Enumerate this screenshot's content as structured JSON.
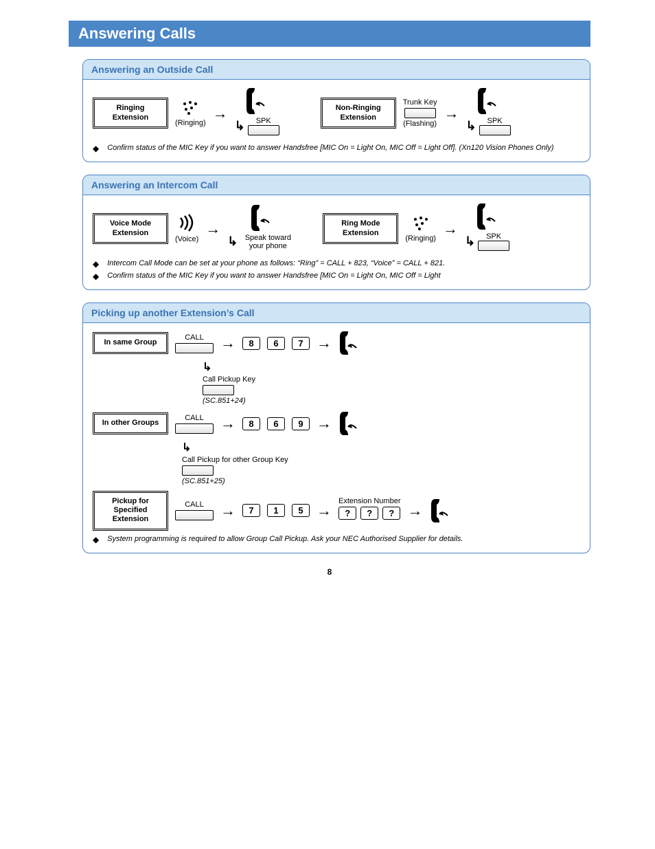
{
  "pageTitle": "Answering Calls",
  "pageNumber": "8",
  "sections": {
    "outside": {
      "header": "Answering an Outside Call",
      "ringing_ext": "Ringing Extension",
      "ringing_lbl": "(Ringing)",
      "spk": "SPK",
      "nonringing_ext": "Non-Ringing Extension",
      "trunk_key": "Trunk Key",
      "flashing_lbl": "(Flashing)",
      "note1": "Confirm status of the MIC Key if you want to answer Handsfree [MIC On = Light On, MIC Off = Light Off].   (Xn120 Vision Phones Only)"
    },
    "intercom": {
      "header": "Answering an Intercom Call",
      "voice_ext": "Voice Mode Extension",
      "voice_lbl": "(Voice)",
      "speak": "Speak toward your phone",
      "ring_ext": "Ring Mode Extension",
      "ringing_lbl": "(Ringing)",
      "spk": "SPK",
      "note1": "Intercom Call Mode can be set at your phone as follows:   “Ring” = CALL + 823,   “Voice” = CALL + 821.",
      "note2": "Confirm status of the MIC Key if you want to answer Handsfree [MIC On = Light On, MIC Off = Light"
    },
    "pickup": {
      "header": "Picking up another Extension’s Call",
      "same_group": "In same Group",
      "other_groups": "In other Groups",
      "specified": "Pickup for Specified Extension",
      "call": "CALL",
      "call_pickup_key": "Call Pickup Key",
      "sc24": "(SC.851+24)",
      "call_pickup_other": "Call Pickup for other Group Key",
      "sc25": "(SC.851+25)",
      "ext_num": "Extension Number",
      "digits": {
        "d8": "8",
        "d6": "6",
        "d7": "7",
        "d9": "9",
        "d1": "1",
        "d5": "5",
        "dq": "?"
      },
      "note1": "System programming is required to allow Group Call Pickup. Ask your NEC Authorised Supplier for details."
    }
  }
}
